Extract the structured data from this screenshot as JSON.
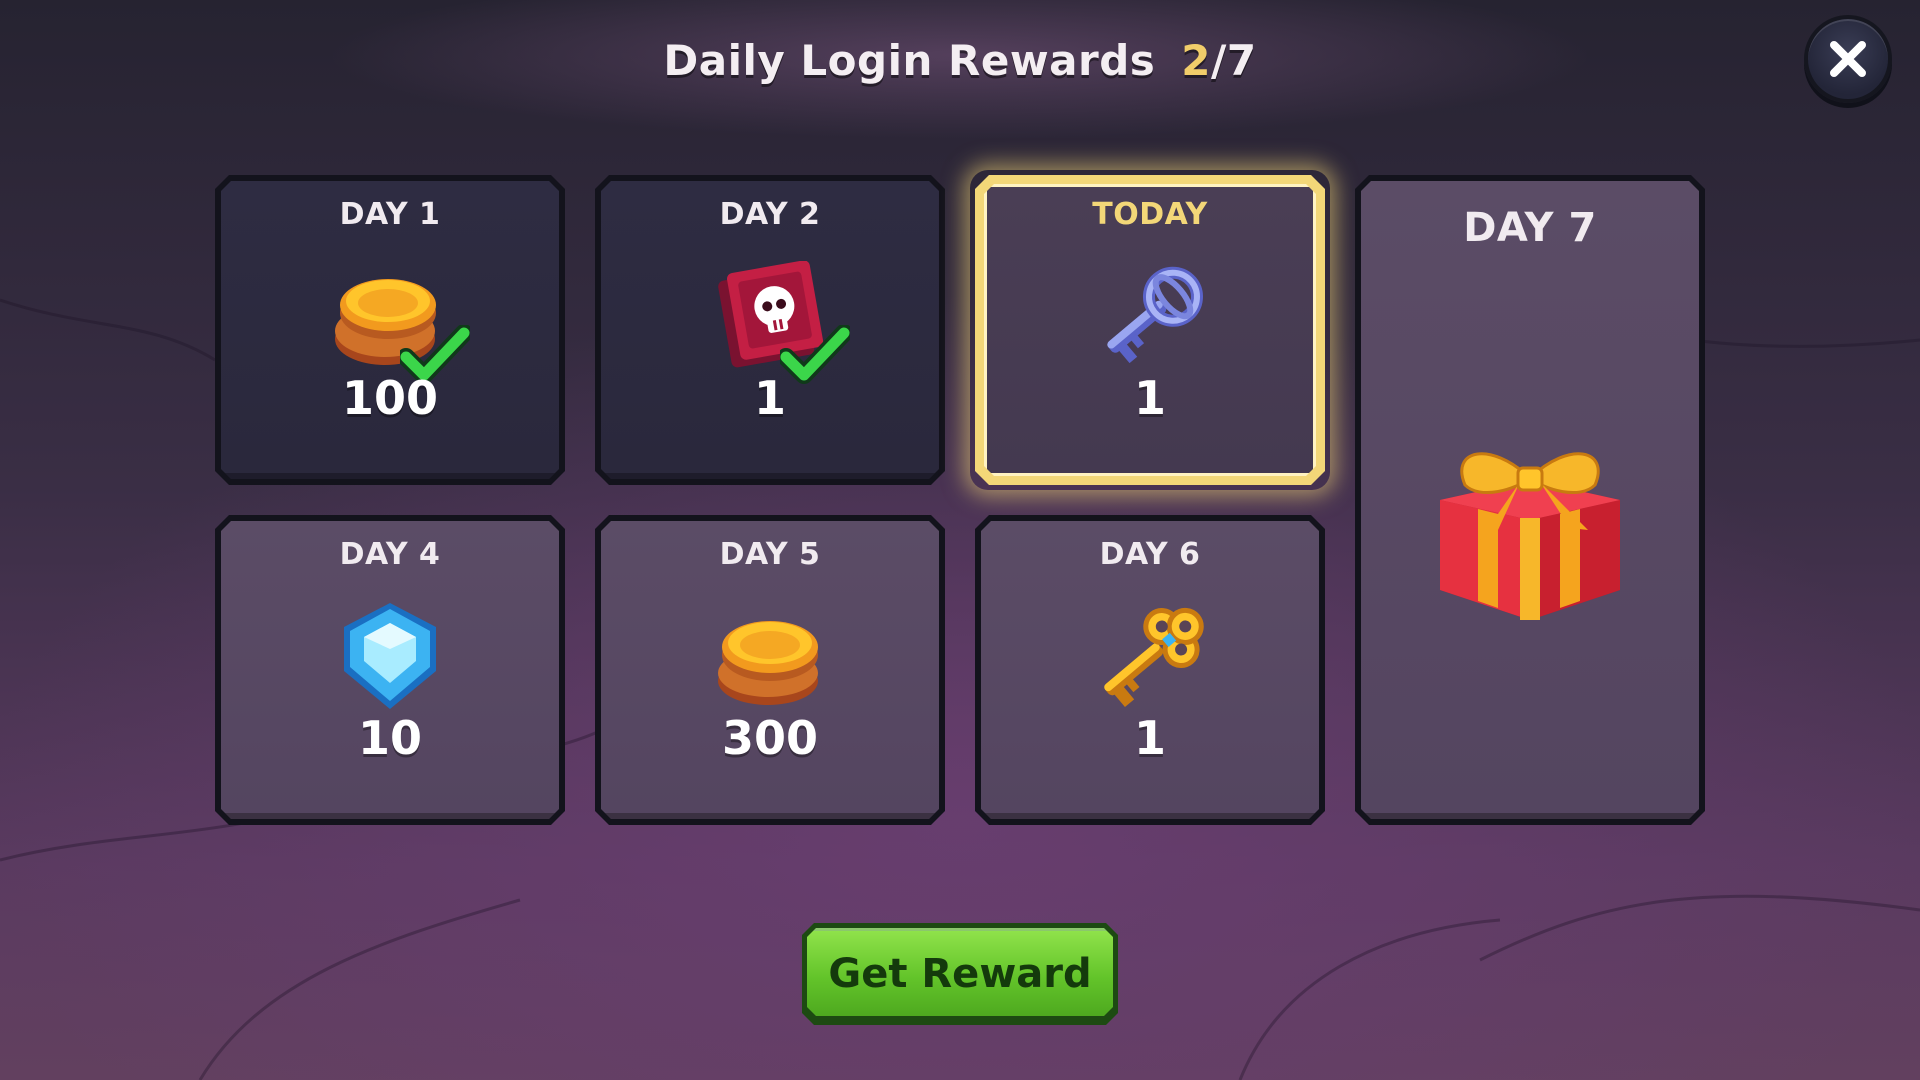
{
  "header": {
    "title": "Daily Login Rewards",
    "progress_current": "2",
    "progress_separator": "/",
    "progress_total": "7"
  },
  "close_button": {
    "icon": "close-icon"
  },
  "days": [
    {
      "label": "DAY 1",
      "amount": "100",
      "reward": "coins",
      "state": "claimed"
    },
    {
      "label": "DAY 2",
      "amount": "1",
      "reward": "skull-ticket",
      "state": "claimed"
    },
    {
      "label": "TODAY",
      "amount": "1",
      "reward": "silver-key",
      "state": "today"
    },
    {
      "label": "DAY 4",
      "amount": "10",
      "reward": "blue-gem",
      "state": "locked"
    },
    {
      "label": "DAY 5",
      "amount": "300",
      "reward": "coins",
      "state": "locked"
    },
    {
      "label": "DAY 6",
      "amount": "1",
      "reward": "gold-key",
      "state": "locked"
    },
    {
      "label": "DAY 7",
      "amount": "",
      "reward": "gift-box",
      "state": "locked"
    }
  ],
  "action": {
    "label": "Get Reward"
  },
  "colors": {
    "accent_gold": "#f3d778",
    "button_green": "#63c42a",
    "claimed_card": "#2e2c42",
    "locked_card": "#5b4c66"
  }
}
